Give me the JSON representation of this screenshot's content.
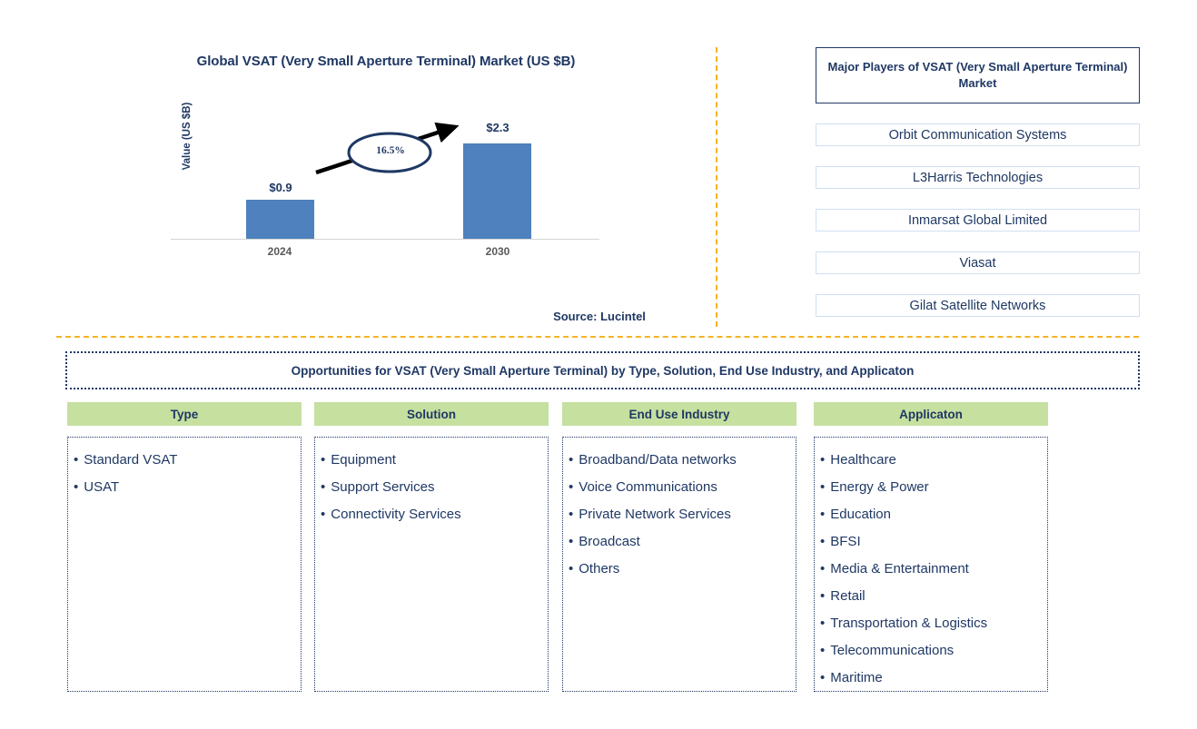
{
  "chart": {
    "title": "Global VSAT (Very Small Aperture Terminal) Market (US $B)",
    "y_axis_label": "Value (US $B)",
    "cagr_label": "16.5%",
    "source": "Source: Lucintel"
  },
  "chart_data": {
    "type": "bar",
    "title": "Global VSAT (Very Small Aperture Terminal) Market (US $B)",
    "xlabel": "",
    "ylabel": "Value (US $B)",
    "categories": [
      "2024",
      "2030"
    ],
    "values": [
      0.9,
      2.3
    ],
    "value_labels": [
      "$0.9",
      "$2.3"
    ],
    "ylim": [
      0,
      2.6
    ],
    "grid": false,
    "legend": false,
    "annotations": [
      {
        "text": "16.5%",
        "kind": "cagr-arrow-ellipse",
        "from": "2024",
        "to": "2030"
      }
    ],
    "series_color": "#4E81BD",
    "source": "Source: Lucintel"
  },
  "players": {
    "title": "Major Players of VSAT (Very Small Aperture Terminal) Market",
    "items": [
      "Orbit Communication Systems",
      "L3Harris Technologies",
      "Inmarsat Global Limited",
      "Viasat",
      "Gilat Satellite Networks"
    ]
  },
  "opportunities": {
    "banner": "Opportunities for VSAT (Very Small Aperture Terminal) by Type, Solution, End Use Industry, and Applicaton",
    "columns": [
      {
        "header": "Type",
        "items": [
          "Standard VSAT",
          "USAT"
        ]
      },
      {
        "header": "Solution",
        "items": [
          "Equipment",
          "Support Services",
          "Connectivity Services"
        ]
      },
      {
        "header": "End Use Industry",
        "items": [
          "Broadband/Data networks",
          "Voice Communications",
          "Private Network Services",
          "Broadcast",
          "Others"
        ]
      },
      {
        "header": "Applicaton",
        "items": [
          "Healthcare",
          "Energy & Power",
          "Education",
          "BFSI",
          "Media & Entertainment",
          "Retail",
          "Transportation & Logistics",
          "Telecommunications",
          "Maritime"
        ]
      }
    ]
  },
  "colors": {
    "navy": "#1F3864",
    "bar_blue": "#4E81BD",
    "header_green": "#C6E0A0",
    "divider_gold": "#F5B324",
    "player_border": "#CFE0F2",
    "axis_gray": "#D4D4D4",
    "tick_gray": "#595959"
  },
  "bullet_glyph": "•"
}
